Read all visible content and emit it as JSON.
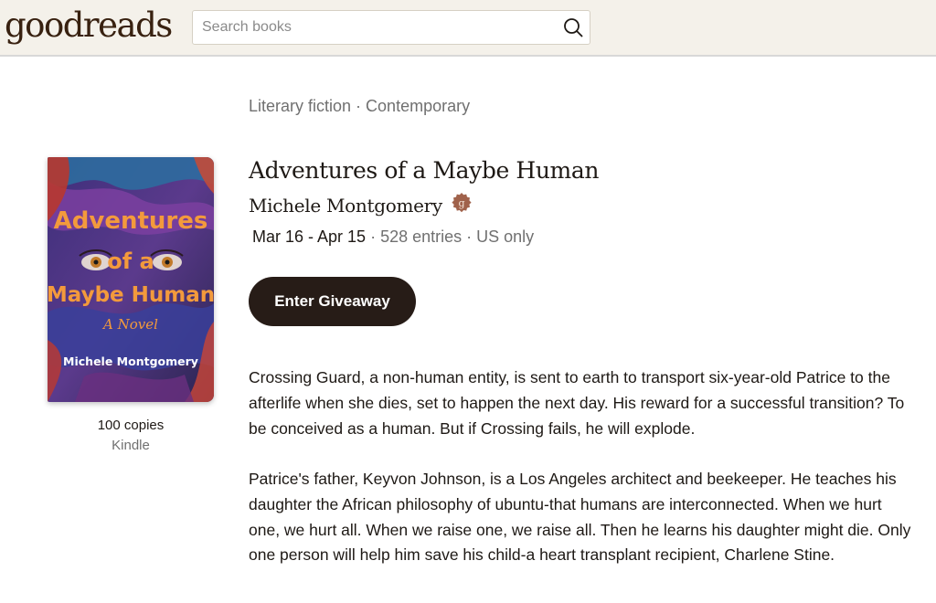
{
  "header": {
    "logo": "goodreads",
    "search_placeholder": "Search books"
  },
  "genres": [
    "Literary fiction",
    "Contemporary"
  ],
  "genre_separator": "·",
  "cover": {
    "title_line1": "Adventures",
    "title_line2": "of a",
    "title_line3": "Maybe Human",
    "subtitle": "A Novel",
    "author": "Michele Montgomery",
    "colors": {
      "title": "#f39a3c",
      "bg_purple": "#5b3a8c",
      "bg_blue": "#2e5a9e",
      "bg_red": "#a83232"
    }
  },
  "giveaway": {
    "copies": "100 copies",
    "format": "Kindle",
    "dates": "Mar 16 - Apr 15",
    "entries": "528 entries",
    "region": "US only",
    "enter_label": "Enter Giveaway"
  },
  "book": {
    "title": "Adventures of a Maybe Human",
    "author": "Michele Montgomery",
    "author_badge_icon": "goodreads-author-badge-icon"
  },
  "description": {
    "p1": "Crossing Guard, a non-human entity, is sent to earth to transport six-year-old Patrice to the afterlife when she dies, set to happen the next day. His reward for a successful transition? To be conceived as a human. But if Crossing fails, he will explode.",
    "p2": "Patrice's father, Keyvon Johnson, is a Los Angeles architect and beekeeper. He teaches his daughter the African philosophy of ubuntu-that humans are interconnected. When we hurt one, we hurt all. When we raise one, we raise all. Then he learns his daughter might die. Only one person will help him save his child-a heart transplant recipient, Charlene Stine."
  },
  "colors": {
    "header_bg": "#f4f1ea",
    "logo": "#382110",
    "button_bg": "#271c17",
    "badge": "#a0624b",
    "muted_text": "#707070"
  }
}
